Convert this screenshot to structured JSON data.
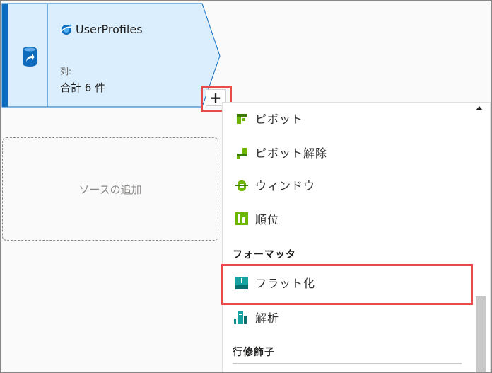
{
  "source_node": {
    "title": "UserProfiles",
    "columns_label": "列:",
    "columns_value": "合計 6 件"
  },
  "add_button": {
    "label": "+"
  },
  "add_source": {
    "label": "ソースの追加"
  },
  "menu": {
    "items_top": [
      {
        "label": "ピボット",
        "icon": "pivot-icon"
      },
      {
        "label": "ピボット解除",
        "icon": "unpivot-icon"
      },
      {
        "label": "ウィンドウ",
        "icon": "window-icon"
      },
      {
        "label": "順位",
        "icon": "rank-icon"
      }
    ],
    "section_formatters": "フォーマッタ",
    "items_formatters": [
      {
        "label": "フラット化",
        "icon": "flatten-icon"
      },
      {
        "label": "解析",
        "icon": "parse-icon"
      }
    ],
    "section_row_modifiers": "行修飾子"
  },
  "colors": {
    "node_fill": "#dbeefd",
    "node_border": "#0f6cbd",
    "highlight": "#e84a4a",
    "icon_green": "#6bb700",
    "icon_teal": "#0f8a8a"
  }
}
